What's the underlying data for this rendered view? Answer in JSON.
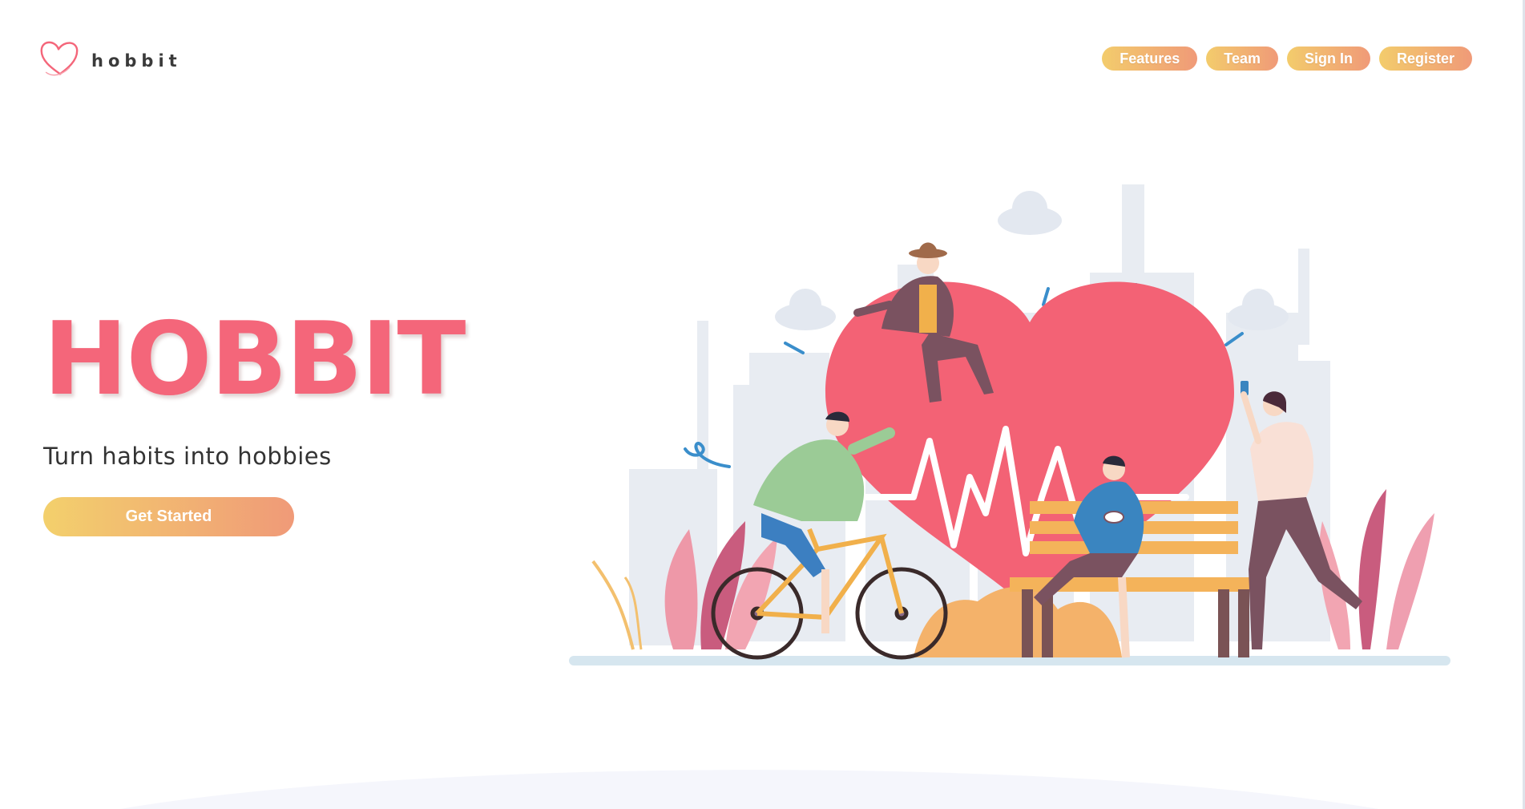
{
  "brand": {
    "name": "hobbit"
  },
  "nav": {
    "features": "Features",
    "team": "Team",
    "sign_in": "Sign In",
    "register": "Register"
  },
  "hero": {
    "title": "HOBBIT",
    "subtitle": "Turn habits into hobbies",
    "cta": "Get Started"
  },
  "colors": {
    "accent_pink": "#f4667a",
    "gradient_start": "#f3cc6c",
    "gradient_end": "#f09a78"
  },
  "icons": {
    "logo": "heart-icon",
    "illustration": "hero-illustration"
  }
}
